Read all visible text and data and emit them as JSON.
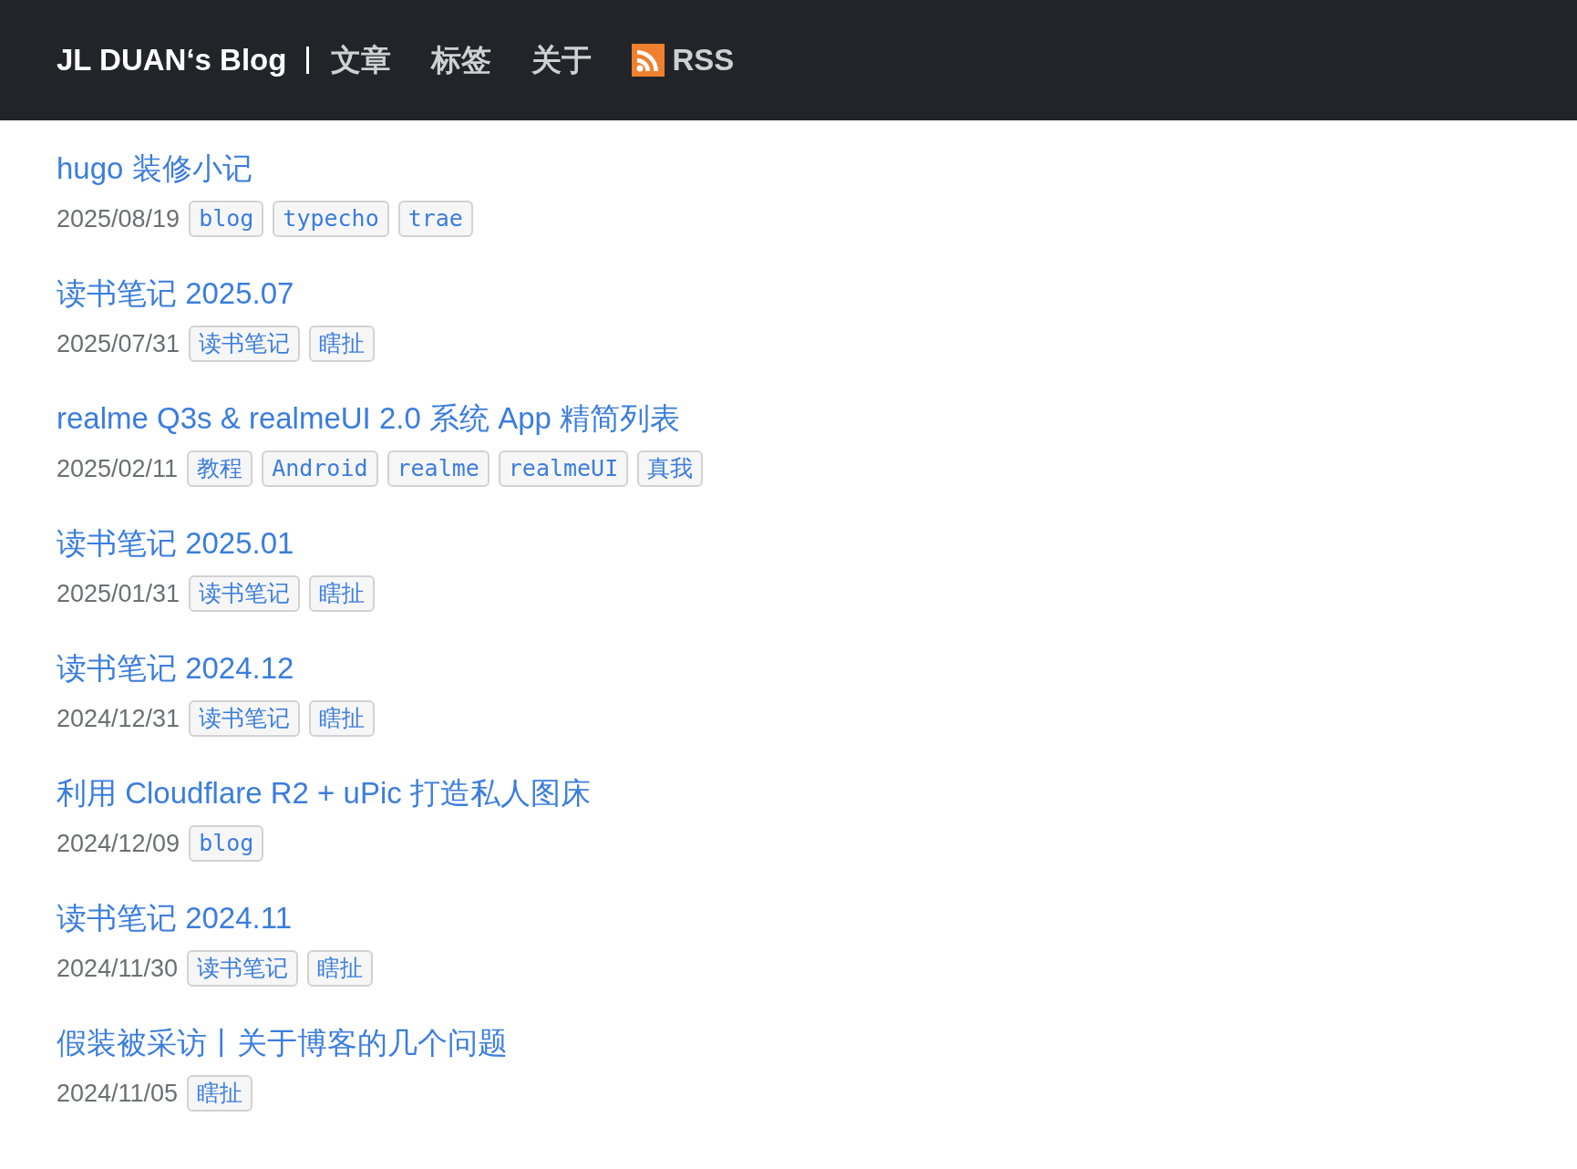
{
  "header": {
    "brand": "JL DUAN‘s Blog",
    "nav": [
      {
        "label": "文章",
        "kind": "link"
      },
      {
        "label": "标签",
        "kind": "link"
      },
      {
        "label": "关于",
        "kind": "link"
      },
      {
        "label": "RSS",
        "kind": "rss"
      }
    ]
  },
  "posts": [
    {
      "title": "hugo 装修小记",
      "date": "2025/08/19",
      "tags": [
        "blog",
        "typecho",
        "trae"
      ]
    },
    {
      "title": "读书笔记 2025.07",
      "date": "2025/07/31",
      "tags": [
        "读书笔记",
        "瞎扯"
      ]
    },
    {
      "title": "realme Q3s & realmeUI 2.0 系统 App 精简列表",
      "date": "2025/02/11",
      "tags": [
        "教程",
        "Android",
        "realme",
        "realmeUI",
        "真我"
      ]
    },
    {
      "title": "读书笔记 2025.01",
      "date": "2025/01/31",
      "tags": [
        "读书笔记",
        "瞎扯"
      ]
    },
    {
      "title": "读书笔记 2024.12",
      "date": "2024/12/31",
      "tags": [
        "读书笔记",
        "瞎扯"
      ]
    },
    {
      "title": "利用 Cloudflare R2 + uPic 打造私人图床",
      "date": "2024/12/09",
      "tags": [
        "blog"
      ]
    },
    {
      "title": "读书笔记 2024.11",
      "date": "2024/11/30",
      "tags": [
        "读书笔记",
        "瞎扯"
      ]
    },
    {
      "title": "假装被采访丨关于博客的几个问题",
      "date": "2024/11/05",
      "tags": [
        "瞎扯"
      ]
    }
  ]
}
